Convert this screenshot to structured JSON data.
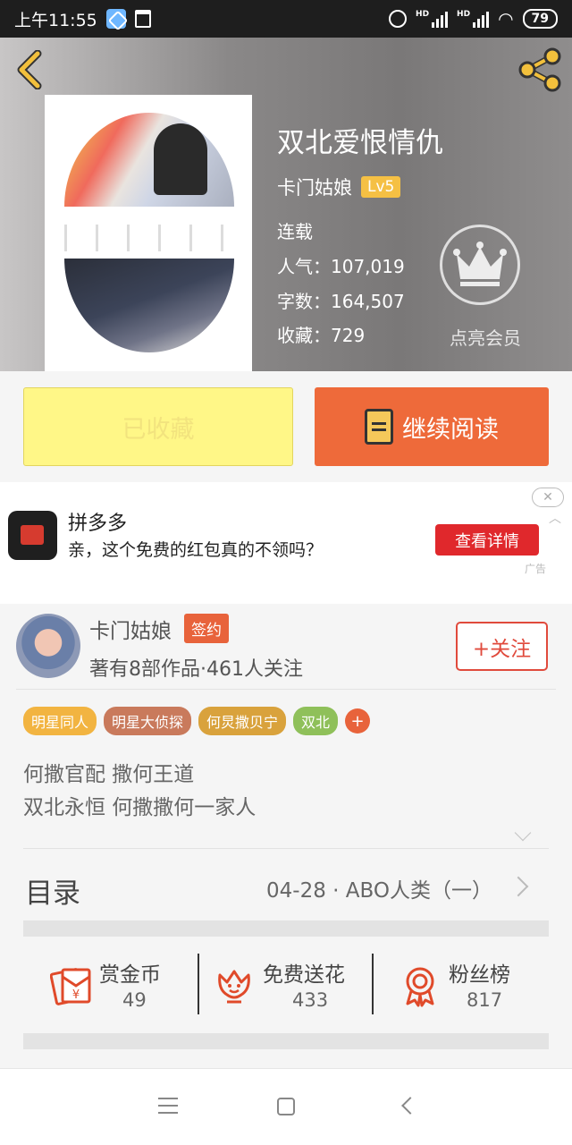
{
  "status_bar": {
    "time": "上午11:55",
    "hd_label": "HD",
    "battery": "79",
    "icons": [
      "app-notification-icon",
      "trash-icon",
      "alarm-icon",
      "signal-icon",
      "wifi-icon",
      "battery-icon"
    ]
  },
  "header": {
    "book_title": "双北爱恨情仇",
    "author": "卡门姑娘",
    "level": "Lv5",
    "status": "连载",
    "popularity_label": "人气：107,019",
    "word_count_label": "字数：164,507",
    "favorites_label": "收藏：729",
    "vip_label": "点亮会员",
    "colors": {
      "level_badge": "#f5c044",
      "accent": "#f2c03c"
    }
  },
  "actions": {
    "collected_label": "已收藏",
    "continue_label": "继续阅读",
    "colors": {
      "collected_bg": "#fff787",
      "continue_bg": "#ee6a3a"
    }
  },
  "ad": {
    "title": "拼多多",
    "description": "亲，这个免费的红包真的不领吗？",
    "button": "查看详情",
    "label": "广告",
    "close": "✕",
    "collapse": "︿"
  },
  "author": {
    "name": "卡门姑娘",
    "badge": "签约",
    "stats": "著有8部作品·461人关注",
    "follow_label": "+关注"
  },
  "tags": [
    {
      "label": "明星同人",
      "color": "#f2b441"
    },
    {
      "label": "明星大侦探",
      "color": "#c97a5c"
    },
    {
      "label": "何炅撒贝宁",
      "color": "#d9a23c"
    },
    {
      "label": "双北",
      "color": "#8fc05a"
    }
  ],
  "tag_add": "+",
  "description": {
    "line1": "何撒官配 撒何王道",
    "line2": "双北永恒 何撒撒何一家人"
  },
  "catalog": {
    "label": "目录",
    "latest": "04-28 · ABO人类（一）"
  },
  "stats": [
    {
      "label": "赏金币",
      "value": "49",
      "icon": "red-envelope-icon"
    },
    {
      "label": "免费送花",
      "value": "433",
      "icon": "flower-icon"
    },
    {
      "label": "粉丝榜",
      "value": "817",
      "icon": "medal-icon"
    }
  ]
}
